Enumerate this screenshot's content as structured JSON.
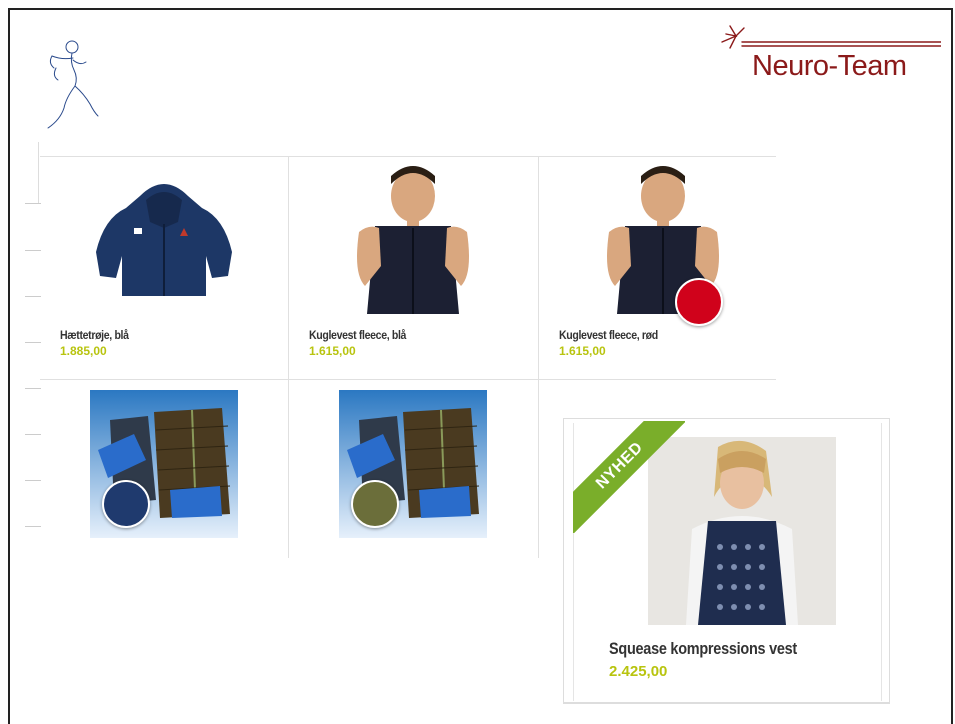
{
  "brand": {
    "logo_text": "Neuro-Team",
    "accent": "#8b1a1a"
  },
  "products": [
    {
      "name": "Hættetrøje, blå",
      "price": "1.885,00",
      "image": "navy-hoodie"
    },
    {
      "name": "Kuglevest fleece, blå",
      "price": "1.615,00",
      "image": "boy-navy-vest"
    },
    {
      "name": "Kuglevest fleece, rød",
      "price": "1.615,00",
      "image": "boy-navy-vest",
      "swatch": "#d0021b"
    },
    {
      "name": "",
      "price": "",
      "image": "quilted-vest",
      "swatch": "#1f3a6e"
    },
    {
      "name": "",
      "price": "",
      "image": "quilted-vest",
      "swatch": "#6b6e3a"
    }
  ],
  "featured": {
    "badge": "NYHED",
    "name": "Squease kompressions vest",
    "price": "2.425,00",
    "image": "girl-compression-vest"
  },
  "colors": {
    "price": "#b8c40f",
    "ribbon": "#7aae2a"
  }
}
